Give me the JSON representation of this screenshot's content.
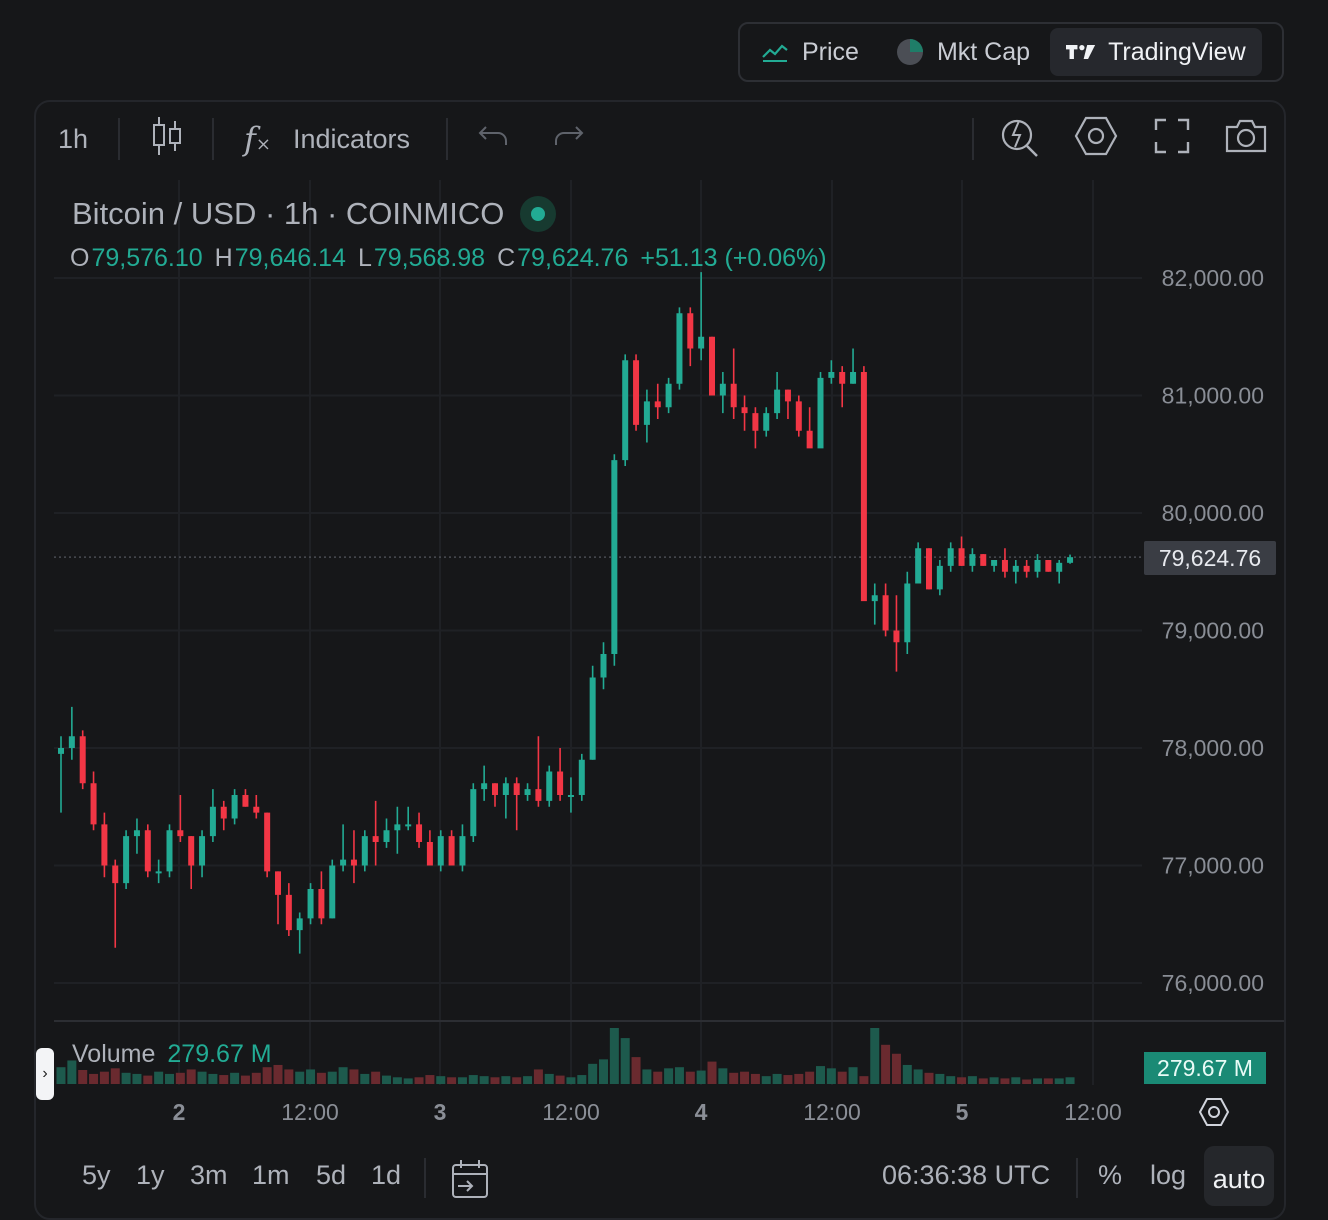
{
  "switcher": {
    "items": [
      {
        "label": "Price",
        "icon": "line-chart-icon",
        "active": false
      },
      {
        "label": "Mkt Cap",
        "icon": "pie-chart-icon",
        "active": false
      },
      {
        "label": "TradingView",
        "icon": "tradingview-logo-icon",
        "active": true
      }
    ]
  },
  "toolbar": {
    "interval": "1h",
    "indicators_label": "Indicators"
  },
  "legend": {
    "title": "Bitcoin / USD · 1h · COINMICO",
    "o_key": "O",
    "o": "79,576.10",
    "h_key": "H",
    "h": "79,646.14",
    "l_key": "L",
    "l": "79,568.98",
    "c_key": "C",
    "c": "79,624.76",
    "change": "+51.13 (+0.06%)"
  },
  "volume": {
    "label": "Volume",
    "value": "279.67 M",
    "badge": "279.67 M"
  },
  "price_badge": "79,624.76",
  "bottom": {
    "ranges": [
      "5y",
      "1y",
      "3m",
      "1m",
      "5d",
      "1d"
    ],
    "time": "06:36:38 UTC",
    "percent": "%",
    "log": "log",
    "auto": "auto"
  },
  "colors": {
    "up": "#22ab94",
    "down": "#f23645",
    "background": "#161719"
  },
  "chart_data": {
    "type": "candlestick",
    "interval": "1h",
    "y_ticks": [
      82000,
      81000,
      80000,
      79000,
      78000,
      77000,
      76000
    ],
    "y_tick_labels": [
      "82,000.00",
      "81,000.00",
      "80,000.00",
      "79,000.00",
      "78,000.00",
      "77,000.00",
      "76,000.00"
    ],
    "ylim": [
      75700,
      82350
    ],
    "x_ticks": [
      "2",
      "12:00",
      "3",
      "12:00",
      "4",
      "12:00",
      "5",
      "12:00"
    ],
    "last_price": 79624.76,
    "candles": [
      [
        77950,
        78100,
        77450,
        78000
      ],
      [
        78000,
        78350,
        77900,
        78100
      ],
      [
        78100,
        78150,
        77650,
        77700
      ],
      [
        77700,
        77800,
        77300,
        77350
      ],
      [
        77350,
        77450,
        76900,
        77000
      ],
      [
        77000,
        77050,
        76300,
        76850
      ],
      [
        76850,
        77300,
        76800,
        77250
      ],
      [
        77250,
        77400,
        77100,
        77300
      ],
      [
        77300,
        77350,
        76900,
        76950
      ],
      [
        76950,
        77050,
        76850,
        76950
      ],
      [
        76950,
        77350,
        76900,
        77300
      ],
      [
        77300,
        77600,
        77200,
        77250
      ],
      [
        77250,
        77250,
        76800,
        77000
      ],
      [
        77000,
        77300,
        76900,
        77250
      ],
      [
        77250,
        77650,
        77200,
        77500
      ],
      [
        77500,
        77550,
        77300,
        77400
      ],
      [
        77400,
        77650,
        77350,
        77600
      ],
      [
        77600,
        77650,
        77500,
        77500
      ],
      [
        77500,
        77600,
        77400,
        77450
      ],
      [
        77450,
        77450,
        76900,
        76950
      ],
      [
        76950,
        76950,
        76500,
        76750
      ],
      [
        76750,
        76850,
        76400,
        76450
      ],
      [
        76450,
        76600,
        76250,
        76550
      ],
      [
        76550,
        76850,
        76500,
        76800
      ],
      [
        76800,
        76950,
        76500,
        76550
      ],
      [
        76550,
        77050,
        76550,
        77000
      ],
      [
        77000,
        77350,
        76950,
        77050
      ],
      [
        77050,
        77300,
        76850,
        77000
      ],
      [
        77000,
        77300,
        76950,
        77250
      ],
      [
        77250,
        77550,
        77000,
        77200
      ],
      [
        77200,
        77400,
        77150,
        77300
      ],
      [
        77300,
        77500,
        77100,
        77350
      ],
      [
        77350,
        77500,
        77300,
        77350
      ],
      [
        77350,
        77450,
        77150,
        77200
      ],
      [
        77200,
        77300,
        77000,
        77000
      ],
      [
        77000,
        77300,
        76950,
        77250
      ],
      [
        77250,
        77300,
        77000,
        77000
      ],
      [
        77000,
        77350,
        76950,
        77250
      ],
      [
        77250,
        77700,
        77200,
        77650
      ],
      [
        77650,
        77850,
        77550,
        77700
      ],
      [
        77700,
        77700,
        77500,
        77600
      ],
      [
        77600,
        77750,
        77400,
        77700
      ],
      [
        77700,
        77750,
        77300,
        77600
      ],
      [
        77600,
        77700,
        77550,
        77650
      ],
      [
        77650,
        78100,
        77500,
        77550
      ],
      [
        77550,
        77850,
        77500,
        77800
      ],
      [
        77800,
        78000,
        77550,
        77600
      ],
      [
        77600,
        77750,
        77450,
        77600
      ],
      [
        77600,
        77950,
        77550,
        77900
      ],
      [
        77900,
        78700,
        77900,
        78600
      ],
      [
        78600,
        78900,
        78500,
        78800
      ],
      [
        78800,
        80500,
        78700,
        80450
      ],
      [
        80450,
        81350,
        80400,
        81300
      ],
      [
        81300,
        81350,
        80700,
        80750
      ],
      [
        80750,
        81050,
        80600,
        80950
      ],
      [
        80950,
        81100,
        80800,
        80900
      ],
      [
        80900,
        81150,
        80850,
        81100
      ],
      [
        81100,
        81750,
        81050,
        81700
      ],
      [
        81700,
        81750,
        81250,
        81400
      ],
      [
        81400,
        82050,
        81300,
        81500
      ],
      [
        81500,
        81500,
        81050,
        81000
      ],
      [
        81000,
        81200,
        80850,
        81100
      ],
      [
        81100,
        81400,
        80800,
        80900
      ],
      [
        80900,
        81000,
        80700,
        80850
      ],
      [
        80850,
        80900,
        80550,
        80700
      ],
      [
        80700,
        80900,
        80650,
        80850
      ],
      [
        80850,
        81200,
        80800,
        81050
      ],
      [
        81050,
        81050,
        80800,
        80950
      ],
      [
        80950,
        81000,
        80650,
        80700
      ],
      [
        80700,
        80900,
        80600,
        80550
      ],
      [
        80550,
        81200,
        80600,
        81150
      ],
      [
        81150,
        81300,
        81100,
        81200
      ],
      [
        81200,
        81250,
        80900,
        81100
      ],
      [
        81100,
        81400,
        81100,
        81200
      ],
      [
        81200,
        81250,
        79300,
        79250
      ],
      [
        79250,
        79400,
        79050,
        79300
      ],
      [
        79300,
        79400,
        78950,
        79000
      ],
      [
        79000,
        79300,
        78650,
        78900
      ],
      [
        78900,
        79500,
        78800,
        79400
      ],
      [
        79400,
        79750,
        79400,
        79700
      ],
      [
        79700,
        79700,
        79350,
        79350
      ],
      [
        79350,
        79600,
        79300,
        79550
      ],
      [
        79550,
        79750,
        79500,
        79700
      ],
      [
        79700,
        79800,
        79550,
        79550
      ],
      [
        79550,
        79700,
        79500,
        79650
      ],
      [
        79650,
        79650,
        79550,
        79550
      ],
      [
        79550,
        79600,
        79500,
        79600
      ],
      [
        79600,
        79700,
        79450,
        79500
      ],
      [
        79500,
        79600,
        79400,
        79550
      ],
      [
        79550,
        79600,
        79450,
        79500
      ],
      [
        79500,
        79650,
        79450,
        79600
      ],
      [
        79600,
        79600,
        79500,
        79500
      ],
      [
        79500,
        79600,
        79400,
        79576
      ],
      [
        79576,
        79646,
        79568,
        79624
      ]
    ],
    "volumes": [
      30,
      42,
      25,
      18,
      22,
      28,
      20,
      18,
      15,
      22,
      18,
      20,
      26,
      22,
      18,
      16,
      20,
      15,
      20,
      30,
      34,
      26,
      22,
      26,
      20,
      22,
      30,
      26,
      18,
      22,
      15,
      12,
      10,
      12,
      16,
      14,
      12,
      12,
      16,
      14,
      12,
      14,
      12,
      14,
      26,
      18,
      15,
      12,
      16,
      36,
      44,
      100,
      82,
      48,
      26,
      22,
      28,
      30,
      22,
      24,
      40,
      28,
      20,
      22,
      18,
      14,
      18,
      16,
      18,
      22,
      32,
      28,
      22,
      30,
      14,
      100,
      70,
      54,
      34,
      26,
      20,
      18,
      14,
      12,
      14,
      10,
      12,
      10,
      12,
      8,
      10,
      10,
      10,
      12,
      8,
      6
    ]
  }
}
